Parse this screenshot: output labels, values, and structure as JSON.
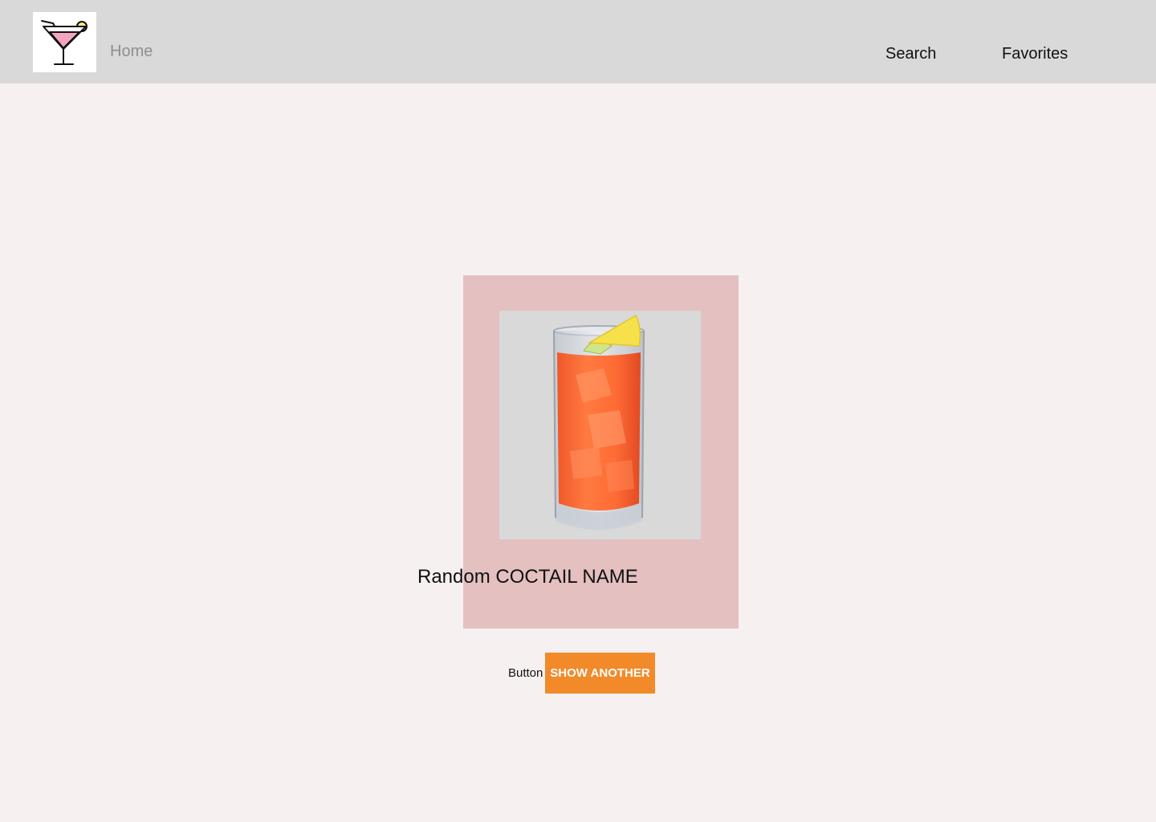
{
  "header": {
    "logo_icon": "cocktail-glass-icon",
    "nav": {
      "home": "Home",
      "search": "Search",
      "favorites": "Favorites"
    }
  },
  "main": {
    "card": {
      "image_subject": "orange cocktail in highball glass with lemon wedge",
      "cocktail_name": "Random COCTAIL NAME"
    },
    "button_caption": "Button",
    "show_another_label": "SHOW ANOTHER"
  },
  "colors": {
    "header_bg": "#d9d9d9",
    "page_bg": "#f7f0f0",
    "card_bg": "#e4c0c0",
    "button_bg": "#f28a2a",
    "button_text": "#ffffff"
  }
}
